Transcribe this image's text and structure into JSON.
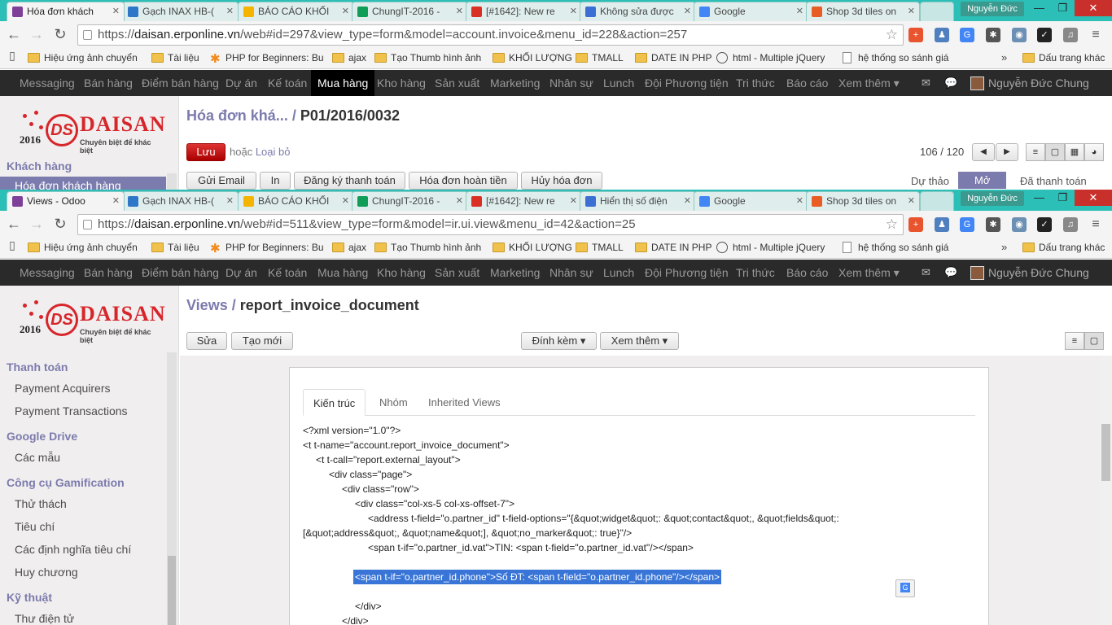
{
  "winA": {
    "tabs": [
      {
        "title": "Hóa đơn khách",
        "fav": "#7d3f98"
      },
      {
        "title": "Gạch INAX HB-(",
        "fav": "#2e77c8"
      },
      {
        "title": "BÁO CÁO KHỐI",
        "fav": "#f4b400"
      },
      {
        "title": "ChungIT-2016 -",
        "fav": "#0f9d58"
      },
      {
        "title": "[#1642]: New re",
        "fav": "#d93025"
      },
      {
        "title": "Không sửa được",
        "fav": "#3b6fd4"
      },
      {
        "title": "Google",
        "fav": "#4285f4"
      },
      {
        "title": "Shop 3d tiles on",
        "fav": "#e85d24"
      }
    ],
    "window_user": "Nguyễn Đức",
    "url_proto": "https://",
    "url_host": "daisan.erponline.vn",
    "url_path": "/web#id=297&view_type=form&model=account.invoice&menu_id=228&action=257",
    "active_menu_index": 5,
    "breadcrumb_parent": "Hóa đơn khá...",
    "breadcrumb_sep": " / ",
    "breadcrumb_current": "P01/2016/0032",
    "save_label": "Lưu",
    "or_label": "hoặc",
    "discard_label": "Loại bỏ",
    "pager": "106 / 120",
    "action_buttons": [
      "Gửi Email",
      "In",
      "Đăng ký thanh toán",
      "Hóa đơn hoàn tiền",
      "Hủy hóa đơn"
    ],
    "stages": [
      "Dự thảo",
      "Mở",
      "Đã thanh toán"
    ],
    "sidebar_header": "Khách hàng",
    "sidebar_selected": "Hóa đơn khách hàng"
  },
  "winB": {
    "tabs": [
      {
        "title": "Views - Odoo",
        "fav": "#7d3f98"
      },
      {
        "title": "Gạch INAX HB-(",
        "fav": "#2e77c8"
      },
      {
        "title": "BÁO CÁO KHỐI",
        "fav": "#f4b400"
      },
      {
        "title": "ChungIT-2016 -",
        "fav": "#0f9d58"
      },
      {
        "title": "[#1642]: New re",
        "fav": "#d93025"
      },
      {
        "title": "Hiển thị số điện",
        "fav": "#3b6fd4"
      },
      {
        "title": "Google",
        "fav": "#4285f4"
      },
      {
        "title": "Shop 3d tiles on",
        "fav": "#e85d24"
      }
    ],
    "window_user": "Nguyễn Đức",
    "url_proto": "https://",
    "url_host": "daisan.erponline.vn",
    "url_path": "/web#id=511&view_type=form&model=ir.ui.view&menu_id=42&action=25",
    "breadcrumb_parent": "Views",
    "breadcrumb_sep": " / ",
    "breadcrumb_current": "report_invoice_document",
    "edit_label": "Sửa",
    "create_label": "Tạo mới",
    "attach_label": "Đính kèm",
    "more_label": "Xem thêm",
    "sidebar": [
      {
        "type": "h",
        "text": "Thanh toán"
      },
      {
        "type": "i",
        "text": "Payment Acquirers"
      },
      {
        "type": "i",
        "text": "Payment Transactions"
      },
      {
        "type": "h",
        "text": "Google Drive"
      },
      {
        "type": "i",
        "text": "Các mẫu"
      },
      {
        "type": "h",
        "text": "Công cụ Gamification"
      },
      {
        "type": "i",
        "text": "Thử thách"
      },
      {
        "type": "i",
        "text": "Tiêu chí"
      },
      {
        "type": "i",
        "text": "Các định nghĩa tiêu chí"
      },
      {
        "type": "i",
        "text": "Huy chương"
      },
      {
        "type": "h",
        "text": "Kỹ thuật"
      },
      {
        "type": "i",
        "text": "Thư điện tử"
      }
    ],
    "form_tabs": [
      "Kiến trúc",
      "Nhóm",
      "Inherited Views"
    ],
    "code_lines": [
      {
        "indent": 0,
        "text": "<?xml version=\"1.0\"?>"
      },
      {
        "indent": 0,
        "text": "<t t-name=\"account.report_invoice_document\">"
      },
      {
        "indent": 1,
        "text": "<t t-call=\"report.external_layout\">"
      },
      {
        "indent": 2,
        "text": "<div class=\"page\">"
      },
      {
        "indent": 3,
        "text": "<div class=\"row\">"
      },
      {
        "indent": 4,
        "text": "<div class=\"col-xs-5 col-xs-offset-7\">"
      },
      {
        "indent": 5,
        "text": "<address t-field=\"o.partner_id\" t-field-options=\"{&quot;widget&quot;: &quot;contact&quot;, &quot;fields&quot;:"
      },
      {
        "indent": 0,
        "text": "[&quot;address&quot;, &quot;name&quot;], &quot;no_marker&quot;: true}\"/>"
      },
      {
        "indent": 5,
        "text": "<span t-if=\"o.partner_id.vat\">TIN: <span t-field=\"o.partner_id.vat\"/></span>"
      },
      {
        "indent": 0,
        "text": ""
      },
      {
        "indent": 4,
        "text": "<span t-if=\"o.partner_id.phone\">Số ĐT: <span t-field=\"o.partner_id.phone\"/></span>",
        "highlight": true
      },
      {
        "indent": 0,
        "text": ""
      },
      {
        "indent": 4,
        "text": "</div>"
      },
      {
        "indent": 3,
        "text": "</div>"
      }
    ]
  },
  "bookmarks": [
    {
      "label": "Hiệu ứng ảnh chuyển",
      "icon": "folder"
    },
    {
      "label": "Tài liệu",
      "icon": "folder"
    },
    {
      "label": "PHP for Beginners: Bu",
      "icon": "orange"
    },
    {
      "label": "ajax",
      "icon": "folder"
    },
    {
      "label": "Tạo Thumb hình ảnh",
      "icon": "folder"
    },
    {
      "label": "KHỐI LƯỢNG",
      "icon": "folder"
    },
    {
      "label": "TMALL",
      "icon": "folder"
    },
    {
      "label": "DATE IN PHP",
      "icon": "folder"
    },
    {
      "label": "html - Multiple jQuery",
      "icon": "globe"
    },
    {
      "label": "hệ thống so sánh giá",
      "icon": "page"
    }
  ],
  "bookmarks_more": "»",
  "bookmarks_other": "Dấu trang khác",
  "odoo_menu": [
    "Messaging",
    "Bán hàng",
    "Điểm bán hàng",
    "Dự án",
    "Kế toán",
    "Mua hàng",
    "Kho hàng",
    "Sản xuất",
    "Marketing",
    "Nhân sự",
    "Lunch",
    "Đội Phương tiện",
    "Tri thức",
    "Báo cáo",
    "Xem thêm ▾"
  ],
  "odoo_user": "Nguyễn Đức Chung",
  "logo": {
    "text": "DAISAN",
    "mark": "DS",
    "year": "2016",
    "tagline": "Chuyên biệt để khác biệt"
  },
  "colors": {
    "accent": "#7c7bad",
    "tabbar": "#2bbfb7",
    "primary": "#c9302c",
    "navbar": "#2a2a2a"
  }
}
